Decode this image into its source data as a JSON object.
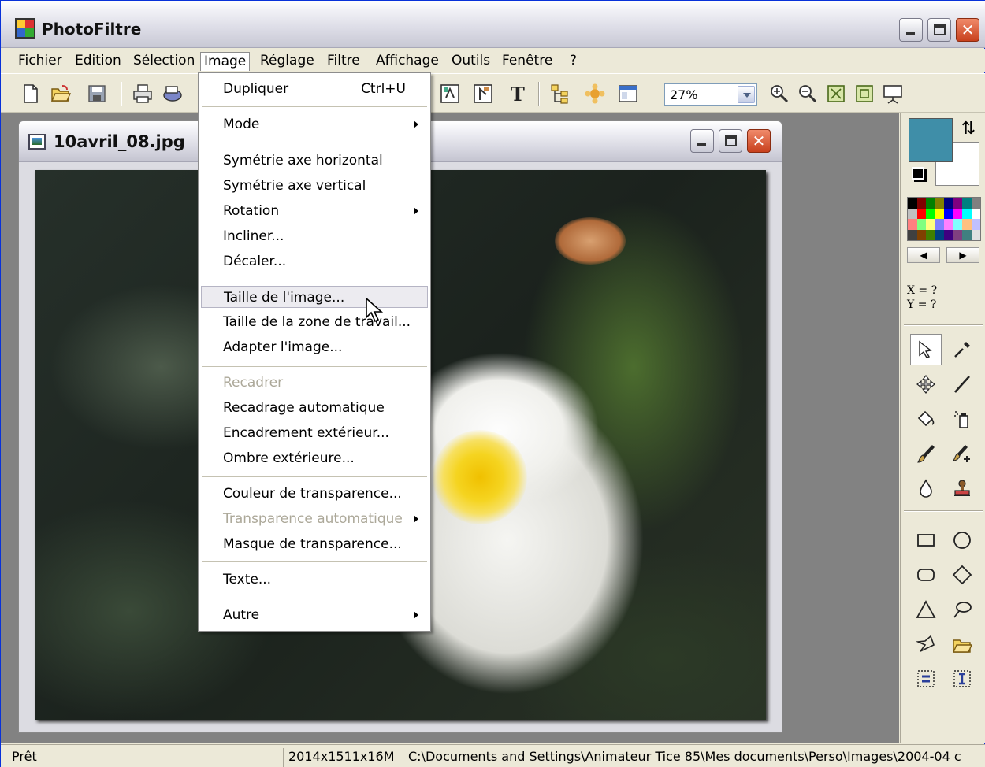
{
  "app": {
    "title": "PhotoFiltre"
  },
  "menubar": [
    "Fichier",
    "Edition",
    "Sélection",
    "Image",
    "Réglage",
    "Filtre",
    "Affichage",
    "Outils",
    "Fenêtre",
    "?"
  ],
  "toolbar": {
    "zoom": "27%"
  },
  "document": {
    "title": "10avril_08.jpg"
  },
  "image_menu": {
    "items": [
      {
        "label": "Dupliquer",
        "shortcut": "Ctrl+U"
      },
      {
        "label": "Mode",
        "submenu": true
      },
      {
        "label": "Symétrie axe horizontal"
      },
      {
        "label": "Symétrie axe vertical"
      },
      {
        "label": "Rotation",
        "submenu": true
      },
      {
        "label": "Incliner..."
      },
      {
        "label": "Décaler..."
      },
      {
        "label": "Taille de l'image...",
        "hover": true
      },
      {
        "label": "Taille de la zone de travail..."
      },
      {
        "label": "Adapter l'image..."
      },
      {
        "label": "Recadrer",
        "disabled": true
      },
      {
        "label": "Recadrage automatique"
      },
      {
        "label": "Encadrement extérieur..."
      },
      {
        "label": "Ombre extérieure..."
      },
      {
        "label": "Couleur de transparence..."
      },
      {
        "label": "Transparence automatique",
        "disabled": true,
        "submenu": true
      },
      {
        "label": "Masque de transparence..."
      },
      {
        "label": "Texte..."
      },
      {
        "label": "Autre",
        "submenu": true
      }
    ]
  },
  "tools_panel": {
    "foreground_color": "#3f8ea8",
    "background_color": "#ffffff",
    "coords_x": "X = ?",
    "coords_y": "Y = ?"
  },
  "statusbar": {
    "status": "Prêt",
    "image_info": "2014x1511x16M",
    "path": "C:\\Documents and Settings\\Animateur Tice 85\\Mes documents\\Perso\\Images\\2004-04 c"
  }
}
